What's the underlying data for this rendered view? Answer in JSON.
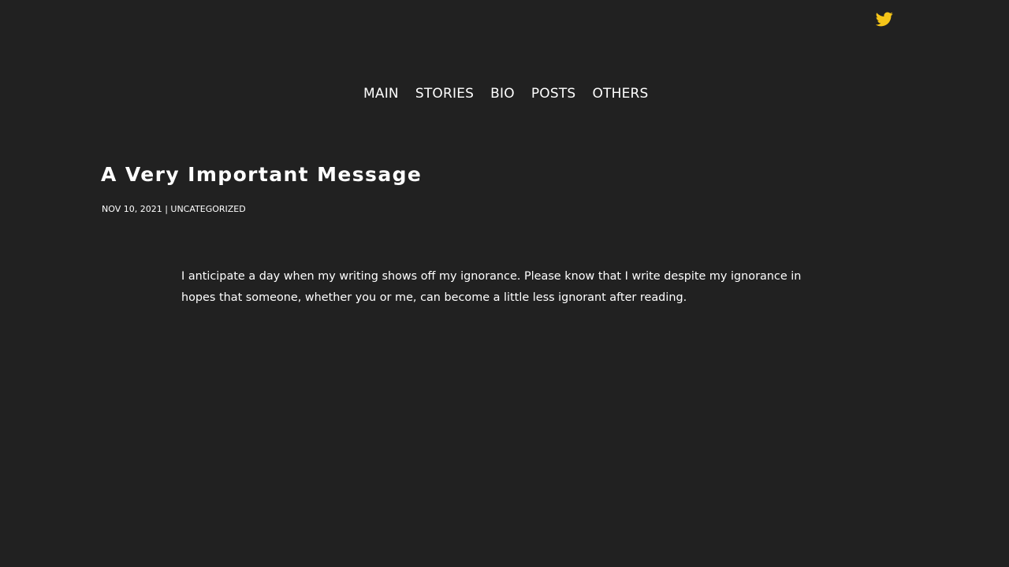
{
  "social": {
    "twitter_icon": "twitter-bird-icon",
    "twitter_color": "#f5c518"
  },
  "nav": {
    "items": [
      {
        "label": "MAIN"
      },
      {
        "label": "STORIES"
      },
      {
        "label": "BIO"
      },
      {
        "label": "POSTS"
      },
      {
        "label": "OTHERS"
      }
    ]
  },
  "post": {
    "title": "A Very Important Message",
    "date": "NOV 10, 2021",
    "separator": " | ",
    "category": "UNCATEGORIZED",
    "body": "I anticipate a day when my writing shows off my ignorance. Please know that I write despite my ignorance in hopes that someone, whether you or me, can become a little less ignorant after reading."
  },
  "colors": {
    "background": "#212121",
    "text": "#ffffff"
  }
}
